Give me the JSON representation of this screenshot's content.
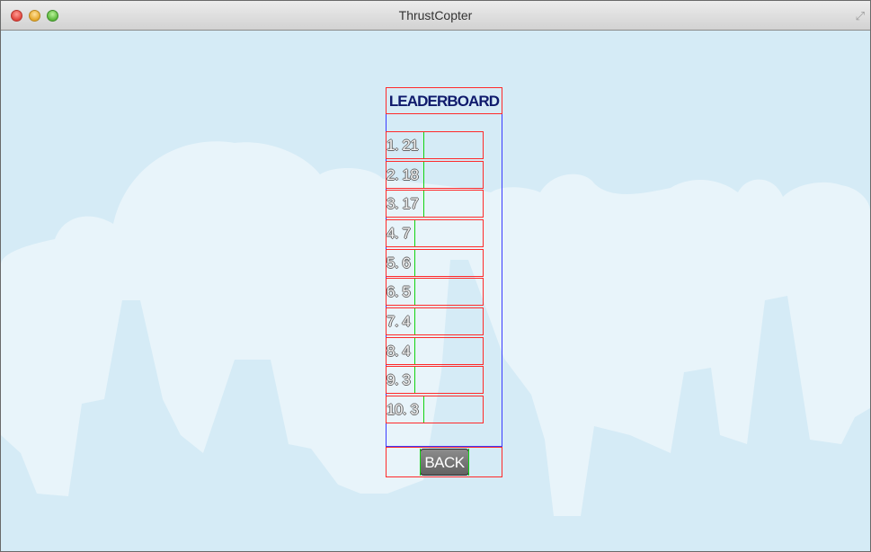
{
  "window": {
    "title": "ThrustCopter"
  },
  "leaderboard": {
    "title": "LEADERBOARD",
    "entries": [
      "1. 21",
      "2. 18",
      "3. 17",
      "4. 7",
      "5. 6",
      "6. 5",
      "7. 4",
      "8. 4",
      "9. 3",
      "10. 3"
    ],
    "back_label": "BACK"
  },
  "colors": {
    "sky": "#d5ebf6",
    "cloud": "#e8f4fa",
    "debug_table": "#ff2a2a",
    "debug_panel": "#3b3bff",
    "debug_cell": "#12d312",
    "title_text": "#0f1a6c"
  }
}
